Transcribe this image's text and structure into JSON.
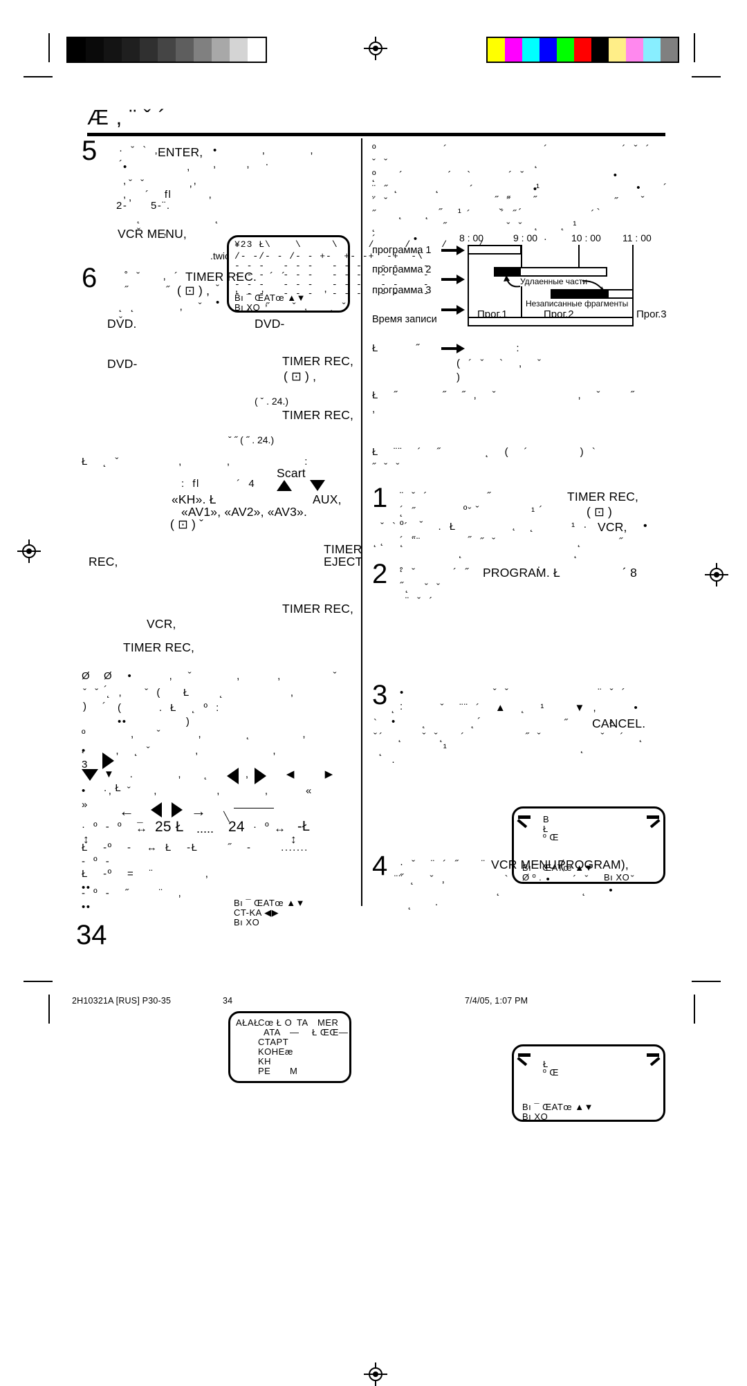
{
  "document": {
    "page_number": "34",
    "title_fragments": "Æ    ,          ¨ ˇ ´",
    "footer": {
      "job_code": "2H10321A [RUS] P30-35",
      "page": "34",
      "timestamp": "7/4/05, 1:07 PM"
    }
  },
  "calibration": {
    "grey_steps": [
      "#000000",
      "#0a0a0a",
      "#141414",
      "#1f1f1f",
      "#303030",
      "#454545",
      "#5e5e5e",
      "#808080",
      "#a8a8a8",
      "#d4d4d4",
      "#ffffff"
    ],
    "color_steps": [
      "#ffff00",
      "#ff00ff",
      "#00ffff",
      "#0000ff",
      "#00ff00",
      "#ff0000",
      "#000000",
      "#ffee88",
      "#ff88ee",
      "#88eeff",
      "#808080"
    ]
  },
  "left_column": {
    "step5": {
      "number": "5",
      "line1_pre": "· ˇ ` , ´",
      "button1": "ENTER,",
      "line1_post": "•      ,      ,      ,    ,  ·",
      "line2": "•        ,     ,         ,            ,",
      "line3": "ˇ ˇ      ,             ,",
      "line4": "´  fl     ,",
      "line5_a": "2-",
      "line5_b": "5-¨.",
      "line6": "˛          ˛  ˇ   ,",
      "button2": "VCR MENU,",
      "line7": ".twice."
    },
    "osd_timer_table": {
      "header": "¥23 Ł\\    \\     \\     /     /     /     /",
      "rows": [
        "/- -/- - /- - +-  +- -+  -+  -\\",
        "- - -   - - -   - - -   - -    -",
        "- - -   - - -   - - -   - -    -",
        "- - -   - - -   - - -   - -    -",
        "- - -   - - -   - - -   - -    -"
      ],
      "footer_line1": "Bı ¯ ŒATœ ▲▼",
      "footer_line2": "Bı XO"
    },
    "step6": {
      "number": "6",
      "line1_pre": "˚ ˇ   , ´ ˝     ˝",
      "button1": "TIMER REC.",
      "line1_post": "´ ´",
      "icon_note": "( ⊡ ) ,",
      "line2": "ˇ  ,   ,        ,        •      ,",
      "line3": "˛ ˛      ,  ˇ      ,  ˝   ˇ ,   ˛ ˇ ˇ",
      "dvd1": "DVD.",
      "dvd2": "DVD-",
      "dvd3": "DVD-",
      "button2": "TIMER REC,",
      "icon_note2": "( ⊡ ) ,",
      "ref1": "(  ˇ  . 24.)",
      "button3": "TIMER REC,",
      "ref2": "ˇ ˝ ( ˝ .   24.)"
    },
    "step_mid": {
      "lead": "Ł  ˛ ˇ        ,      ,          :",
      "colon_line": ": fl     ´ 4",
      "scart": "Scart",
      "kh": "«KH». Ł",
      "aux": "AUX,",
      "av": "«AV1»,        «AV2»,        «AV3».",
      "icon_note": "( ⊡ ) ˇ",
      "timer": "TIMER",
      "rec": "REC,",
      "eject": "EJECT",
      "button_timer_rec2": "TIMER REC,",
      "vcr": "VCR,",
      "button_timer_rec3": "TIMER REC,"
    },
    "step_note": {
      "marker": "Ø",
      "l1": "Ø  •     ,  ˇ      ,     ,       ˇ  ´",
      "l2": "ˇ ˇ ˛ ,   ˇ (   Ł    ˛         ,          )  ´",
      "l3": "(     . Ł  ˛ º :                     ••        )",
      "l4": "º      ,   ˇ     ,      ˛       ,      ˛",
      "l5": "•    ,  ˛ ˇ      ,          ,              3",
      "l6": "▼  .      ,   ˛     ,     ◀    ▶    . Ł",
      "l7": "•   ,  ˇ   ,        ,      ,     «     »",
      "range_pre": "· º - º  ¯",
      "range_a": "25 Ł",
      "range_dots": ".....",
      "range_b": "24",
      "range_post": "· º",
      "range_tail": "-Ł",
      "l8": "Ł  -º  -  ↔ Ł  -Ł    ˝  -    .......  - º -",
      "l9": "Ł  -º  =  ¨       ,        ••",
      "l10": "- º -  ˝    ¨  ,          ••"
    },
    "osd_program": {
      "line1_a": "AŁAŁ",
      "line1_b": "Cœ Ł O",
      "line1_c": "TA",
      "line1_d": "MER",
      "line2_a": "ATA",
      "line2_b": "—",
      "line2_c": "Ł ŒŒ—",
      "line3": "CTAPT",
      "line4": "KOHEæ",
      "line5": "KH",
      "line6_a": "PE",
      "line6_b": "M",
      "footer1": "Bı ¯ ŒATœ ▲▼",
      "footer2": "CT-KA ◀▶",
      "footer3": "Bı XO"
    }
  },
  "right_column": {
    "intro": {
      "l1": "º         ´             ´          ´ ˇ ´                 ˇ ˇ",
      "l2": "                      ˛                     ˛",
      "l3": "º   ´      ´  `     ´ ˇ            •              ¨ ˝           ´        •",
      "l4": "   ˛     ˛             ¹             •   ´         ´ ˇ                ˝              ˝",
      "l5": "¨                ˝ ˝   ˝              ˇ     ˝   ˛   ˛     ´    ´ ˝          ´",
      "l6": "         ˝  ¹     ˇ  ´          `               ˛         ˝        ˇ ˇ",
      "l7": "                      ˛   ˛ ¹            ´     •                 ·",
      "l8": "              ¹            ˛"
    },
    "timeline": {
      "rows": [
        {
          "label": "программа 1"
        },
        {
          "label": "программа 2"
        },
        {
          "label": "программа 3"
        },
        {
          "label": "Время записи"
        }
      ],
      "time_ticks": [
        "8 : 00",
        "9 : 00",
        "10 : 00",
        "11 : 00"
      ],
      "annotation_deleted": "Удлаенные части",
      "annotation_unrecorded": "Незаписанные фрагменты",
      "program_blocks": [
        "Прог.1",
        "Прог.2",
        "Прог.3"
      ]
    },
    "mid_notes": {
      "n1_mark": "Ł",
      "n1": "Ł     ˝             :",
      "n1b": "( ´ ˇ  `  ,  ˇ          )",
      "n2_mark": "Ł",
      "n2": "Ł  ˝      ˝  ˝ ,  ˇ           ,  ˇ    ˝     ,",
      "n3_mark": "Ł",
      "n3": "Ł  ¨¨  ´  ˝      ˛  (  ´       ) `",
      "n3b": "˝ ˇ ˇ"
    },
    "step1": {
      "number": "1",
      "l1": "¨ ˇ ´        ˝               ´        º ˇ        ´",
      "button1": "TIMER REC,",
      "l2": "˛ ˝       ˇ        ¹          º  ˇ            ˛",
      "icon": "( ⊡ )",
      "l3": "ˇ ` ´    . Ł          ˛     ¹ ·       ˛  ´ ˝       ˝",
      "button2": "VCR,",
      "bullet": "•",
      "l4": "˛   ˛ ¨¨        ˝ ˇ           ˛     ˝",
      "l5": "        ˛               ˛            ˛                  ·"
    },
    "step2": {
      "number": "2",
      "l1": "˚ ˇ     ´ ˝     ˝",
      "button1": "PROGRAM. Ł",
      "l2": "´      8",
      "l3": "˛  ˇ ˇ       ¨ ˇ ´"
    },
    "osd_box2": {
      "line1": "B",
      "line2": "Ł",
      "line3": "º Œ",
      "footer1": "Bı ¯ ŒATœ ▲▼",
      "footer2": "Ø    º   .",
      "footer3": "Bı XO"
    },
    "step3": {
      "number": "3",
      "l1": "•            ˇ ˇ            ¨ ˇ ´        :",
      "l2": "˛      ˇ  ¨¨ ´  ▲  ˛  ¹    ▼ ,     •          •           ´",
      "l3": "`      ˛      ˛            ˝    . Ł   ˇ      ˇ ˇ   ´",
      "button1": "CANCEL.",
      "l4": "´  ˛     ˛           ˝ ˇ        ˇ  ´  ˛          ˛",
      "l5": "       ¹                  ˛              ·"
    },
    "osd_box3": {
      "line1": "Ł",
      "line2": "º Œ",
      "footer1": "Bı ¯ ŒATœ ▲▼",
      "footer2": "Bı XO"
    },
    "step4": {
      "number": "4",
      "l1": "· ˇ  ¨ ´ ˝   ¨   ˝",
      "button1": "VCR MENU (",
      "button2": "PROGRAM),",
      "l2": "¨¨ ˛  ˇ ,        `     •   ´ ˇ    ´ ˇ",
      "l3": "            ˛           ˛   •        ˛   ·"
    }
  }
}
